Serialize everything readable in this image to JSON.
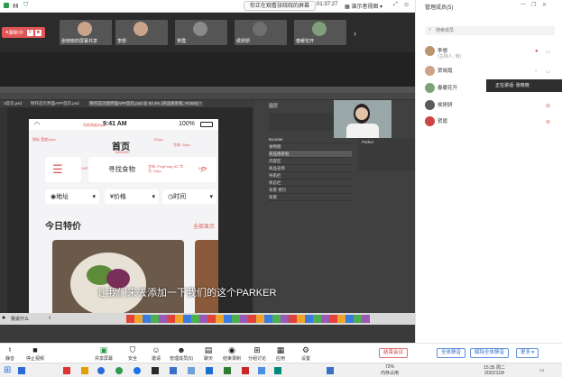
{
  "topbar": {
    "sharing_text": "你正在观看张晓晓的屏幕"
  },
  "timer": {
    "value": "01:37:27"
  },
  "gallery_view": {
    "label": "演示者视图"
  },
  "right_header": {
    "title": "管理成员(5)"
  },
  "recording": {
    "label": "录制中"
  },
  "video_tiles": [
    {
      "name": "张晓晓的屏幕共享"
    },
    {
      "name": "李想"
    },
    {
      "name": "贺霞"
    },
    {
      "name": "侯妍妍"
    },
    {
      "name": "春暖花开"
    }
  ],
  "ps": {
    "file_tab1": "3首页.psd",
    "file_tab2": "制作首页界面APP首页.psd",
    "file_tab3": "制作首页图界面APP首页.psd @ 93.3% (商品搜索框, RGB/8) *",
    "layers_title": "图层",
    "layers": [
      "Bounter",
      "食物图",
      "商品搜索框",
      "内容区",
      "商品名称",
      "导航栏",
      "状态栏",
      "背景 拷贝",
      "背景"
    ],
    "parker_label": "Parker"
  },
  "phone": {
    "time": "9:41 AM",
    "battery": "100%",
    "title": "首页",
    "title_tag": "#5D4037",
    "search_text": "寻找食物",
    "search_hint": "字体: PingFang SC 字号: 30px",
    "filters": [
      "地址",
      "价格",
      "时间"
    ],
    "today_special": "今日特价",
    "show_all": "全部显示",
    "anno1": "导航高度88px",
    "anno2": "字体: 36px",
    "anno3": "图标 宽度44px",
    "anno4": "120px",
    "anno5": "24PX",
    "anno6": "24PX"
  },
  "subtitle": {
    "text": "让我们来去添加一下我们的这个PARKER"
  },
  "share_footer": {
    "label": "我说什么"
  },
  "search": {
    "placeholder": "搜索成员"
  },
  "participants": [
    {
      "name": "李想",
      "sub": "(主持人, 我)"
    },
    {
      "name": "贺晓霞",
      "sub": ""
    },
    {
      "name": "春暖花开",
      "sub": ""
    },
    {
      "name": "侯妍妍",
      "sub": ""
    },
    {
      "name": "贺霞",
      "sub": ""
    }
  ],
  "speaking": {
    "text": "正在讲话: 张晓晓"
  },
  "bottom_tools": [
    {
      "label": "静音",
      "icon": "mic-icon"
    },
    {
      "label": "停止视频",
      "icon": "camera-icon"
    },
    {
      "label": "共享屏幕",
      "icon": "share-screen-icon"
    },
    {
      "label": "安全",
      "icon": "shield-icon"
    },
    {
      "label": "邀请",
      "icon": "invite-icon"
    },
    {
      "label": "管理成员(5)",
      "icon": "members-icon"
    },
    {
      "label": "聊天",
      "icon": "chat-icon"
    },
    {
      "label": "结束录制",
      "icon": "record-icon"
    },
    {
      "label": "分组讨论",
      "icon": "group-icon"
    },
    {
      "label": "应用",
      "icon": "apps-icon"
    },
    {
      "label": "设置",
      "icon": "gear-icon"
    }
  ],
  "end_meeting": "结束会议",
  "mute_all": "全体静音",
  "unmute_all": "解除全体静音",
  "more": "更多",
  "taskbar": {
    "mem": "72%",
    "mem_label": "内存占用",
    "time": "15:35 周二",
    "date": "2022/11/8"
  },
  "colors": {
    "accent_red": "#e05555",
    "accent_blue": "#3a70c8"
  }
}
